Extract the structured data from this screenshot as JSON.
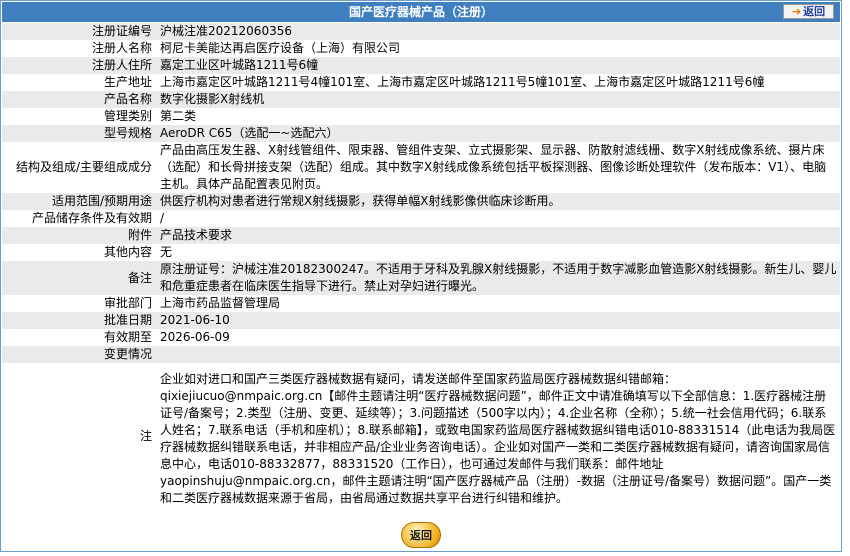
{
  "title": "国产医疗器械产品（注册）",
  "back_top_label": "返回",
  "back_bottom_label": "返回",
  "fields": [
    {
      "key": "注册证编号",
      "value": "沪械注准20212060356"
    },
    {
      "key": "注册人名称",
      "value": "柯尼卡美能达再启医疗设备（上海）有限公司"
    },
    {
      "key": "注册人住所",
      "value": "嘉定工业区叶城路1211号6幢"
    },
    {
      "key": "生产地址",
      "value": "上海市嘉定区叶城路1211号4幢101室、上海市嘉定区叶城路1211号5幢101室、上海市嘉定区叶城路1211号6幢"
    },
    {
      "key": "产品名称",
      "value": "数字化摄影X射线机"
    },
    {
      "key": "管理类别",
      "value": "第二类"
    },
    {
      "key": "型号规格",
      "value": "AeroDR C65（选配一~选配六）"
    },
    {
      "key": "结构及组成/主要组成成分",
      "value": "产品由高压发生器、X射线管组件、限束器、管组件支架、立式摄影架、显示器、防散射滤线栅、数字X射线成像系统、摄片床（选配）和长骨拼接支架（选配）组成。其中数字X射线成像系统包括平板探测器、图像诊断处理软件（发布版本：V1）、电脑主机。具体产品配置表见附页。"
    },
    {
      "key": "适用范围/预期用途",
      "value": "供医疗机构对患者进行常规X射线摄影，获得单幅X射线影像供临床诊断用。"
    },
    {
      "key": "产品储存条件及有效期",
      "value": "/"
    },
    {
      "key": "附件",
      "value": "产品技术要求"
    },
    {
      "key": "其他内容",
      "value": "无"
    },
    {
      "key": "备注",
      "value": "原注册证号：沪械注准20182300247。不适用于牙科及乳腺X射线摄影，不适用于数字减影血管造影X射线摄影。新生儿、婴儿和危重症患者在临床医生指导下进行。禁止对孕妇进行曝光。"
    },
    {
      "key": "审批部门",
      "value": "上海市药品监督管理局"
    },
    {
      "key": "批准日期",
      "value": "2021-06-10"
    },
    {
      "key": "有效期至",
      "value": "2026-06-09"
    },
    {
      "key": "变更情况",
      "value": ""
    }
  ],
  "note": {
    "key": "注",
    "value": "企业如对进口和国产三类医疗器械数据有疑问，请发送邮件至国家药监局医疗器械数据纠错邮箱：qixiejiucuo@nmpaic.org.cn【邮件主题请注明“医疗器械数据问题”，邮件正文中请准确填写以下全部信息：1.医疗器械注册证号/备案号；2.类型（注册、变更、延续等）；3.问题描述（500字以内）；4.企业名称（全称）；5.统一社会信用代码；6.联系人姓名；7.联系电话（手机和座机）；8.联系邮箱】，或致电国家药监局医疗器械数据纠错电话010-88331514（此电话为我局医疗器械数据纠错联系电话，并非相应产品/企业业务咨询电话）。企业如对国产一类和二类医疗器械数据有疑问，请咨询国家局信息中心，电话010-88332877，88331520（工作日），也可通过发邮件与我们联系：邮件地址yaopinshuju@nmpaic.org.cn，邮件主题请注明“国产医疗器械产品（注册）-数据（注册证号/备案号）数据问题”。国产一类和二类医疗器械数据来源于省局，由省局通过数据共享平台进行纠错和维护。"
  }
}
